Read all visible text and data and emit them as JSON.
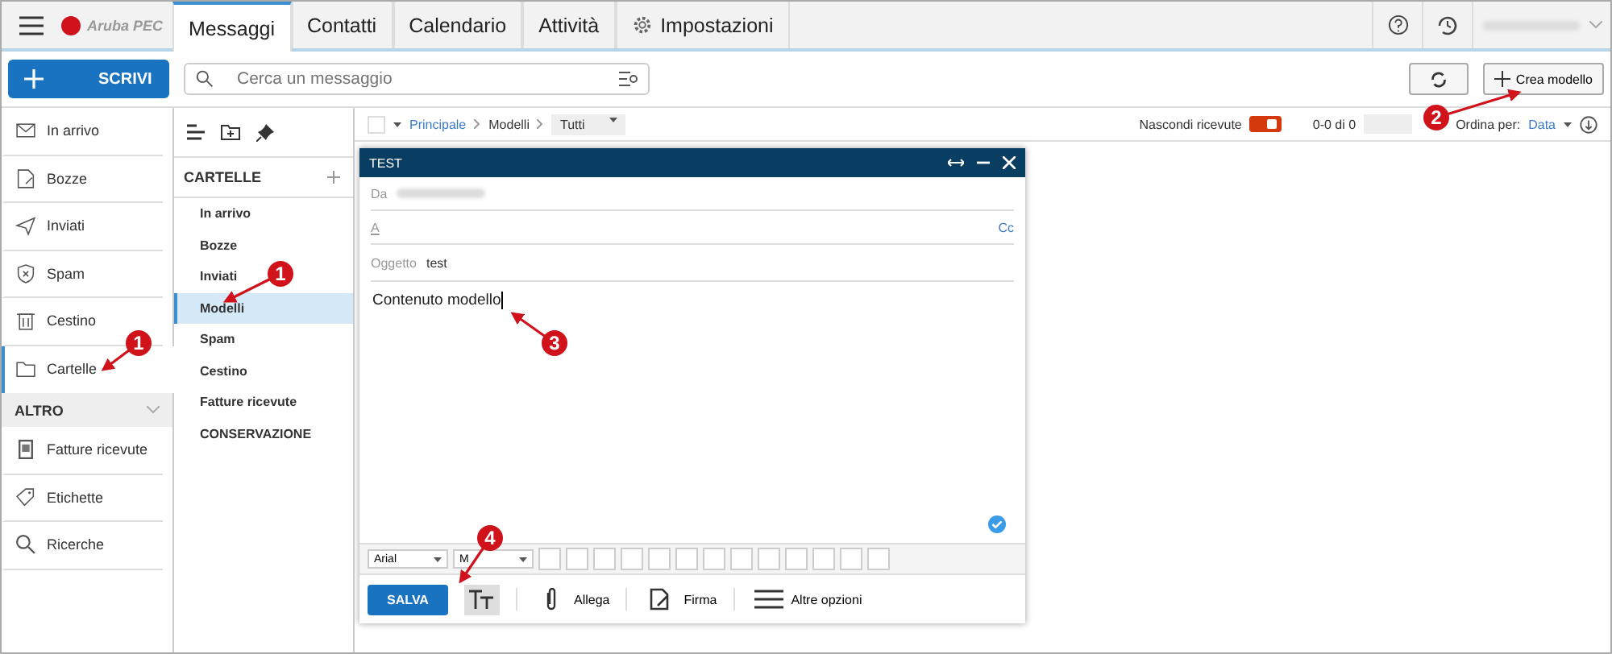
{
  "top_bar": {
    "logo": "Aruba PEC",
    "tabs": [
      {
        "label": "Messaggi",
        "selected": true,
        "kind": "text"
      },
      {
        "label": "Contatti",
        "selected": false,
        "kind": "text"
      },
      {
        "label": "Calendario",
        "selected": false,
        "kind": "text"
      },
      {
        "label": "Attività",
        "selected": false,
        "kind": "text"
      },
      {
        "label": "Impostazioni",
        "selected": false,
        "kind": "gear"
      }
    ]
  },
  "compose_button": "SCRIVI",
  "search": {
    "placeholder": "Cerca un messaggio"
  },
  "create_button": "Crea modello",
  "nav": {
    "items": [
      {
        "label": "In arrivo",
        "kind": "inbox",
        "selected": false
      },
      {
        "label": "Bozze",
        "kind": "draft",
        "selected": false
      },
      {
        "label": "Inviati",
        "kind": "sent",
        "selected": false
      },
      {
        "label": "Spam",
        "kind": "spam",
        "selected": false
      },
      {
        "label": "Cestino",
        "kind": "trash",
        "selected": false
      },
      {
        "label": "Cartelle",
        "kind": "folder",
        "selected": true
      }
    ],
    "section": {
      "title": "ALTRO",
      "expanded": true
    },
    "more_items": [
      {
        "label": "Fatture ricevute",
        "kind": "invoice",
        "selected": false
      },
      {
        "label": "Etichette",
        "kind": "tag",
        "selected": false
      },
      {
        "label": "Ricerche",
        "kind": "search",
        "selected": false
      }
    ]
  },
  "folders": {
    "title": "CARTELLE",
    "items": [
      {
        "label": "In arrivo",
        "selected": false
      },
      {
        "label": "Bozze",
        "selected": false
      },
      {
        "label": "Inviati",
        "selected": false
      },
      {
        "label": "Modelli",
        "selected": true
      },
      {
        "label": "Spam",
        "selected": false
      },
      {
        "label": "Cestino",
        "selected": false
      },
      {
        "label": "Fatture ricevute",
        "selected": false
      },
      {
        "label": "CONSERVAZIONE",
        "selected": false
      }
    ]
  },
  "list_bar": {
    "select_all": {
      "checked": false
    },
    "breadcrumb": [
      "Principale",
      "Modelli"
    ],
    "filter": "Tutti",
    "hide_received": {
      "label": "Nascondi ricevute",
      "on": true
    },
    "count": "0-0 di 0",
    "sort_label": "Ordina per:",
    "sort_value": "Data"
  },
  "compose": {
    "title": "TEST",
    "from_label": "Da",
    "to_label": "A",
    "cc": "Cc",
    "subject_label": "Oggetto",
    "subject": "test",
    "body": "Contenuto modello",
    "font": "Arial",
    "size": "M",
    "save": "SALVA",
    "actions": [
      {
        "label": "Allega",
        "kind": "clip"
      },
      {
        "label": "Firma",
        "kind": "sign"
      },
      {
        "label": "Altre opzioni",
        "kind": "menu"
      }
    ]
  },
  "annotations": [
    {
      "number": "1"
    },
    {
      "number": "1"
    },
    {
      "number": "2"
    },
    {
      "number": "3"
    },
    {
      "number": "4"
    }
  ]
}
